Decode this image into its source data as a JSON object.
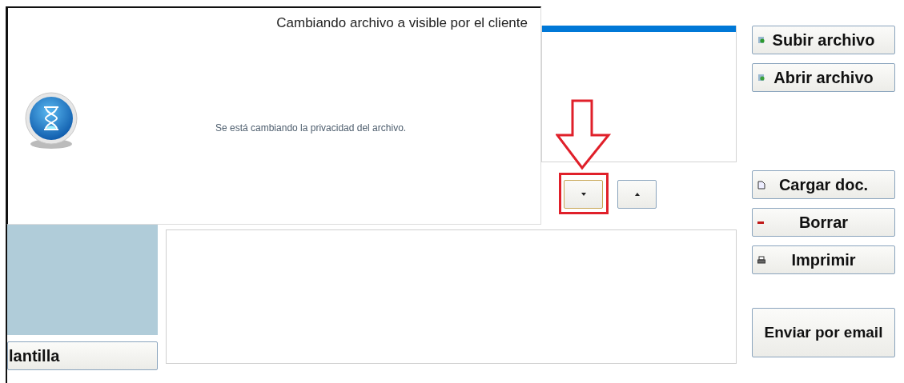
{
  "dialog": {
    "title": "Cambiando archivo a visible por el cliente",
    "message": "Se está cambiando la privacidad del archivo."
  },
  "file_list": {
    "rows": [
      {
        "selected": true
      }
    ]
  },
  "order_buttons": [
    {
      "kind": "down",
      "focused": true,
      "annotated": true
    },
    {
      "kind": "up",
      "focused": false,
      "annotated": false
    }
  ],
  "button_groups": [
    {
      "buttons": [
        {
          "label": "Subir archivo",
          "kind": "upload"
        },
        {
          "label": "Abrir archivo",
          "kind": "open"
        }
      ]
    },
    {
      "buttons": [
        {
          "label": "Cargar doc.",
          "kind": "document"
        },
        {
          "label": "Borrar",
          "kind": "delete"
        },
        {
          "label": "Imprimir",
          "kind": "print"
        }
      ]
    },
    {
      "buttons": [
        {
          "label": "Enviar por email",
          "kind": "plain"
        }
      ]
    }
  ],
  "template_button": {
    "label": "lantilla"
  }
}
